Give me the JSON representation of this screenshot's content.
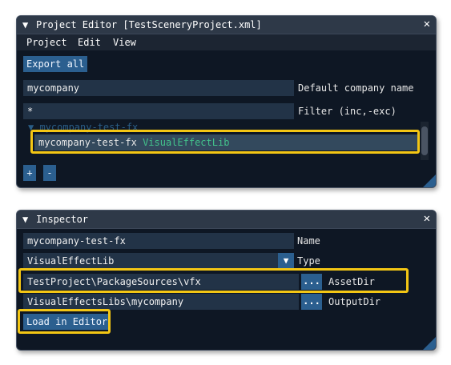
{
  "project_editor": {
    "title": "Project Editor [TestSceneryProject.xml]",
    "menu": [
      "Project",
      "Edit",
      "View"
    ],
    "export_all_label": "Export all",
    "company_value": "mycompany",
    "company_label": "Default company name",
    "filter_value": "*",
    "filter_label": "Filter (inc,-exc)",
    "tree": {
      "parent": "mycompany-test-fx",
      "selected_name": "mycompany-test-fx",
      "selected_type": "VisualEffectLib"
    },
    "add_label": "+",
    "remove_label": "-"
  },
  "inspector": {
    "title": "Inspector",
    "name_value": "mycompany-test-fx",
    "name_label": "Name",
    "type_value": "VisualEffectLib",
    "type_label": "Type",
    "asset_dir_value": "TestProject\\PackageSources\\vfx",
    "asset_dir_label": "AssetDir",
    "output_dir_value": "VisualEffectsLibs\\mycompany",
    "output_dir_label": "OutputDir",
    "browse_label": "...",
    "load_label": "Load in Editor"
  },
  "icons": {
    "collapse": "triangle-down-icon",
    "close": "close-icon",
    "dropdown": "dropdown-arrow-icon",
    "resize": "resize-grip-icon"
  },
  "colors": {
    "highlight": "#f3c614",
    "button": "#2b5f8f",
    "panel_bg": "#0e1724",
    "type_text": "#43c28b"
  }
}
